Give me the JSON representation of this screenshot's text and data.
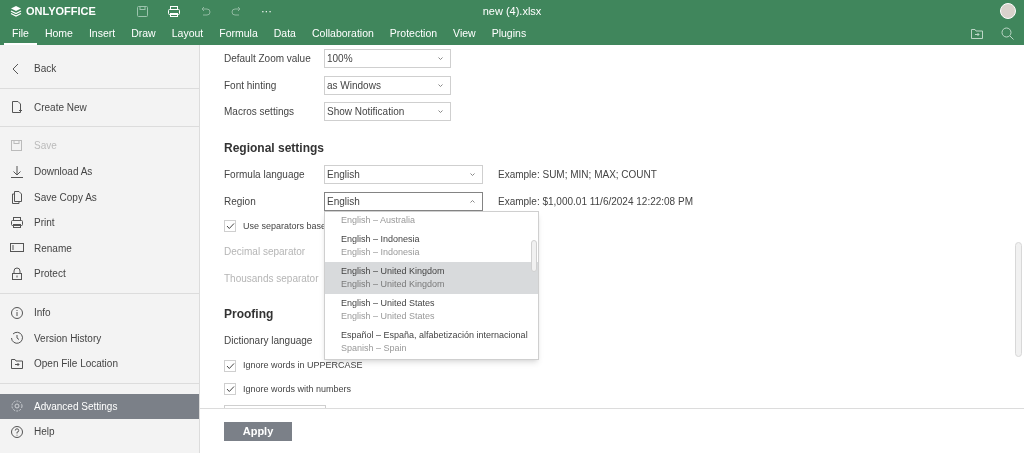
{
  "header": {
    "app_name": "ONLYOFFICE",
    "title": "new (4).xlsx",
    "more": "···"
  },
  "tabs": [
    {
      "label": "File",
      "selected": true
    },
    {
      "label": "Home",
      "selected": false
    },
    {
      "label": "Insert",
      "selected": false
    },
    {
      "label": "Draw",
      "selected": false
    },
    {
      "label": "Layout",
      "selected": false
    },
    {
      "label": "Formula",
      "selected": false
    },
    {
      "label": "Data",
      "selected": false
    },
    {
      "label": "Collaboration",
      "selected": false
    },
    {
      "label": "Protection",
      "selected": false
    },
    {
      "label": "View",
      "selected": false
    },
    {
      "label": "Plugins",
      "selected": false
    }
  ],
  "sidebar": {
    "groups": [
      [
        {
          "label": "Back",
          "disabled": false,
          "selected": false
        }
      ],
      [
        {
          "label": "Create New",
          "disabled": false,
          "selected": false
        }
      ],
      [
        {
          "label": "Save",
          "disabled": true,
          "selected": false
        },
        {
          "label": "Download As",
          "disabled": false,
          "selected": false
        },
        {
          "label": "Save Copy As",
          "disabled": false,
          "selected": false
        },
        {
          "label": "Print",
          "disabled": false,
          "selected": false
        },
        {
          "label": "Rename",
          "disabled": false,
          "selected": false
        },
        {
          "label": "Protect",
          "disabled": false,
          "selected": false
        }
      ],
      [
        {
          "label": "Info",
          "disabled": false,
          "selected": false
        },
        {
          "label": "Version History",
          "disabled": false,
          "selected": false
        },
        {
          "label": "Open File Location",
          "disabled": false,
          "selected": false
        }
      ],
      [
        {
          "label": "Advanced Settings",
          "disabled": false,
          "selected": true
        },
        {
          "label": "Help",
          "disabled": false,
          "selected": false
        }
      ]
    ]
  },
  "settings": [
    {
      "kind": "select",
      "label": "Default Zoom value",
      "value": "100%",
      "wide": false,
      "expanded": false
    },
    {
      "kind": "select",
      "label": "Font hinting",
      "value": "as Windows",
      "wide": false,
      "expanded": false
    },
    {
      "kind": "select",
      "label": "Macros settings",
      "value": "Show Notification",
      "wide": false,
      "expanded": false
    },
    {
      "kind": "heading",
      "label": "Regional settings"
    },
    {
      "kind": "select",
      "label": "Formula language",
      "value": "English",
      "wide": true,
      "expanded": false,
      "note": "Example: SUM; MIN; MAX; COUNT"
    },
    {
      "kind": "select",
      "label": "Region",
      "value": "English",
      "wide": true,
      "expanded": true,
      "note": "Example: $1,000.01 11/6/2024 12:22:08 PM"
    },
    {
      "kind": "checkbox",
      "label": "Use separators base",
      "checked": true
    },
    {
      "kind": "label",
      "label": "Decimal separator",
      "disabled": true
    },
    {
      "kind": "label",
      "label": "Thousands separator",
      "disabled": true
    },
    {
      "kind": "heading",
      "label": "Proofing"
    },
    {
      "kind": "label",
      "label": "Dictionary language",
      "disabled": false
    },
    {
      "kind": "checkbox",
      "label": "Ignore words in UPPERCASE",
      "checked": true
    },
    {
      "kind": "checkbox",
      "label": "Ignore words with numbers",
      "checked": true
    },
    {
      "kind": "button"
    }
  ],
  "region_options": [
    {
      "sublabel": "English – Australia",
      "selected": false
    },
    {
      "label": "English – Indonesia",
      "sublabel": "English – Indonesia",
      "selected": false
    },
    {
      "label": "English – United Kingdom",
      "sublabel": "English – United Kingdom",
      "selected": true
    },
    {
      "label": "English – United States",
      "sublabel": "English – United States",
      "selected": false
    },
    {
      "label": "Español – España, alfabetización internacional",
      "sublabel": "Spanish – Spain",
      "selected": false
    }
  ],
  "apply_button": "Apply"
}
